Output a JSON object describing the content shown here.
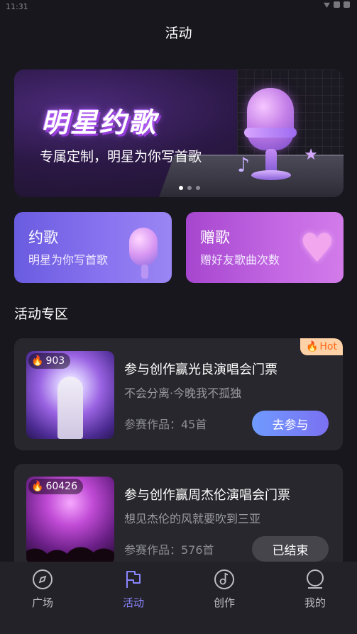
{
  "status_bar": {
    "time": "11:31"
  },
  "page": {
    "title": "活动"
  },
  "banner": {
    "title": "明星约歌",
    "subtitle": "专属定制，明星为你写首歌",
    "pages": 3,
    "active_page": 1
  },
  "features": [
    {
      "title": "约歌",
      "subtitle": "明星为你写首歌",
      "icon": "microphone-icon"
    },
    {
      "title": "赠歌",
      "subtitle": "赠好友歌曲次数",
      "icon": "heart-icon"
    }
  ],
  "section": {
    "title": "活动专区"
  },
  "activities": [
    {
      "heat": "903",
      "hot_label": "Hot",
      "title": "参与创作赢光良演唱会门票",
      "subtitle": "不会分离·今晚我不孤独",
      "count": "参赛作品：45首",
      "button": "去参与",
      "status": "active"
    },
    {
      "heat": "60426",
      "title": "参与创作赢周杰伦演唱会门票",
      "subtitle": "想见杰伦的风就要吹到三亚",
      "count": "参赛作品：576首",
      "button": "已结束",
      "status": "ended"
    }
  ],
  "nav": {
    "items": [
      {
        "label": "广场",
        "icon": "compass-icon"
      },
      {
        "label": "活动",
        "icon": "flag-icon"
      },
      {
        "label": "创作",
        "icon": "music-disc-icon"
      },
      {
        "label": "我的",
        "icon": "profile-icon"
      }
    ],
    "active": "活动"
  },
  "colors": {
    "background": "#18171d",
    "accent": "#8a86ff",
    "join_button": "#7b70f1",
    "hot": "#ff6b1a"
  }
}
